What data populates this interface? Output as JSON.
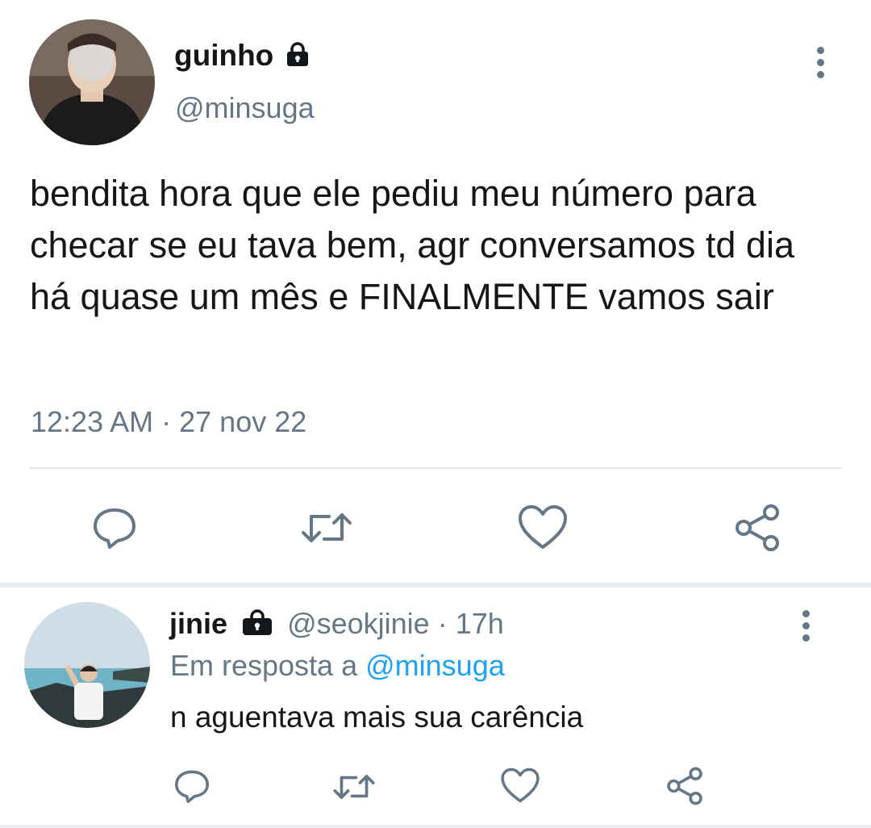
{
  "tweet": {
    "author_name": "guinho",
    "author_handle": "@minsuga",
    "text": "bendita hora que ele pediu meu número para checar se eu tava bem, agr conversamos td dia há quase um mês e FINALMENTE vamos sair",
    "time": "12:23 AM",
    "separator": "·",
    "date": "27 nov 22",
    "icons": [
      "lock-icon",
      "more-options-icon",
      "reply-icon",
      "retweet-icon",
      "like-icon",
      "share-icon"
    ]
  },
  "reply": {
    "author_name": "jinie",
    "author_handle": "@seokjinie",
    "separator": "·",
    "age": "17h",
    "replying_prefix": "Em resposta a",
    "replying_handle": "@minsuga",
    "text": "n aguentava mais sua carência"
  },
  "colors": {
    "text": "#14171a",
    "muted": "#657786",
    "link": "#1da1f2",
    "divider": "#e1e8ed"
  }
}
